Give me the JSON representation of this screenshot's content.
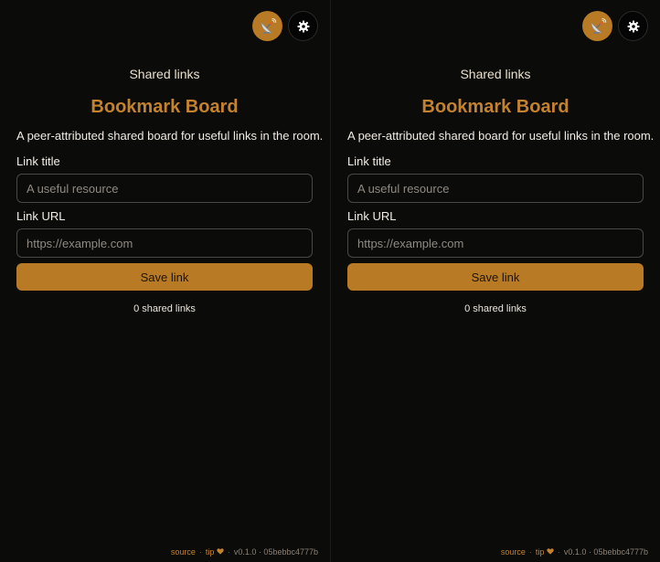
{
  "panes": [
    {
      "peer_button_icon": "satellite-dish-icon",
      "settings_button_icon": "gear-icon",
      "kicker": "Shared links",
      "title": "Bookmark Board",
      "subtitle": "A peer-attributed shared board for useful links in the room.",
      "title_field": {
        "label": "Link title",
        "value": "",
        "placeholder": "A useful resource"
      },
      "url_field": {
        "label": "Link URL",
        "value": "",
        "placeholder": "https://example.com"
      },
      "save_label": "Save link",
      "count_text": "0 shared links",
      "footer": {
        "source_label": "source",
        "separator": "·",
        "tip_label": "tip",
        "tip_icon": "heart-icon",
        "version": "v0.1.0 · 05bebbc4777b"
      }
    },
    {
      "peer_button_icon": "satellite-dish-icon",
      "settings_button_icon": "gear-icon",
      "kicker": "Shared links",
      "title": "Bookmark Board",
      "subtitle": "A peer-attributed shared board for useful links in the room.",
      "title_field": {
        "label": "Link title",
        "value": "",
        "placeholder": "A useful resource"
      },
      "url_field": {
        "label": "Link URL",
        "value": "",
        "placeholder": "https://example.com"
      },
      "save_label": "Save link",
      "count_text": "0 shared links",
      "footer": {
        "source_label": "source",
        "separator": "·",
        "tip_label": "tip",
        "tip_icon": "heart-icon",
        "version": "v0.1.0 · 05bebbc4777b"
      }
    }
  ],
  "colors": {
    "accent": "#b87a24",
    "title": "#c3822e",
    "background": "#0b0b0a",
    "input_border": "#4a4843"
  }
}
